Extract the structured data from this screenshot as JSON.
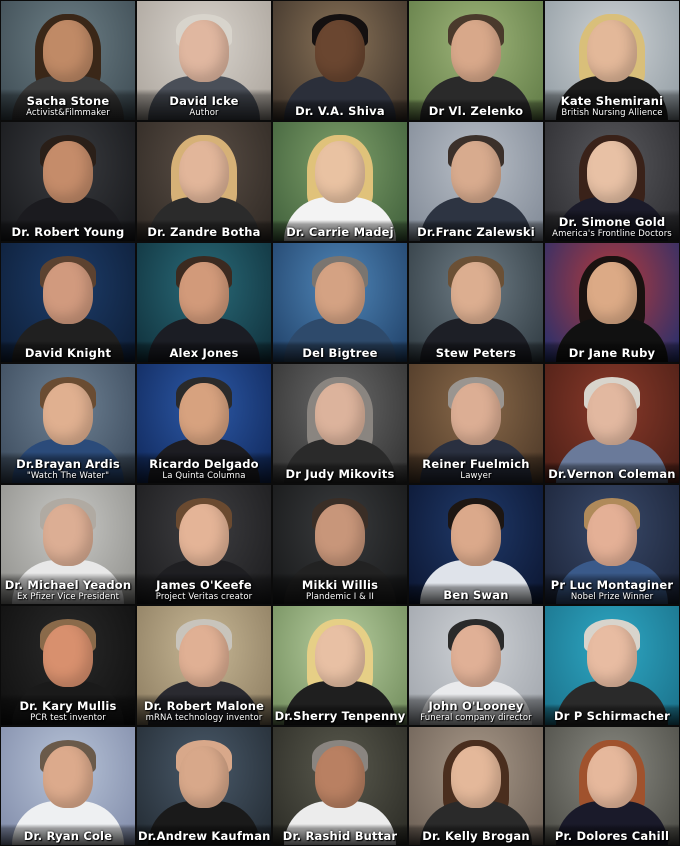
{
  "people": [
    {
      "name": "Sacha Stone",
      "title": "Activist&Filmmaker",
      "bg": "#6d7f86",
      "bg2": "#3c4a52",
      "skin": "#c08a66",
      "hair": "#3a2718",
      "long_hair": true,
      "shirt": "#3b3b3b"
    },
    {
      "name": "David Icke",
      "title": "Author",
      "bg": "#d9d4cd",
      "bg2": "#a9a29a",
      "skin": "#e0b7a0",
      "hair": "#d8d4cc",
      "long_hair": false,
      "shirt": "#4a4f58"
    },
    {
      "name": "Dr. V.A. Shiva",
      "title": "",
      "bg": "#8a7358",
      "bg2": "#3a3028",
      "skin": "#6a4630",
      "hair": "#141010",
      "long_hair": false,
      "shirt": "#2b2f3a"
    },
    {
      "name": "Dr Vl. Zelenko",
      "title": "",
      "bg": "#9fb57a",
      "bg2": "#5f7a45",
      "skin": "#d8a88a",
      "hair": "#4a3a2c",
      "long_hair": false,
      "shirt": "#2a2a2a"
    },
    {
      "name": "Kate Shemirani",
      "title": "British Nursing Allience",
      "bg": "#cfd3d6",
      "bg2": "#8f9aa1",
      "skin": "#e3b899",
      "hair": "#d9bf7a",
      "long_hair": true,
      "shirt": "#1d1d1d"
    },
    {
      "name": "Dr. Robert Young",
      "title": "",
      "bg": "#3a3c40",
      "bg2": "#16171a",
      "skin": "#c58c6a",
      "hair": "#2a1f18",
      "long_hair": false,
      "shirt": "#1b1b1f"
    },
    {
      "name": "Dr. Zandre Botha",
      "title": "",
      "bg": "#5b4f46",
      "bg2": "#2e2823",
      "skin": "#e2b69a",
      "hair": "#d6b177",
      "long_hair": true,
      "shirt": "#2b2b2b"
    },
    {
      "name": "Dr. Carrie Madej",
      "title": "",
      "bg": "#7fa06a",
      "bg2": "#3e5e3a",
      "skin": "#e9c2a2",
      "hair": "#e0c27a",
      "long_hair": true,
      "shirt": "#f3f3f3"
    },
    {
      "name": "Dr.Franc Zalewski",
      "title": "",
      "bg": "#b9bfc7",
      "bg2": "#7f8895",
      "skin": "#d8ab8e",
      "hair": "#3b302a",
      "long_hair": false,
      "shirt": "#2d3442"
    },
    {
      "name": "Dr. Simone Gold",
      "title": "America's Frontline Doctors",
      "bg": "#5a5a5e",
      "bg2": "#2a2a2e",
      "skin": "#e8c1a5",
      "hair": "#3a2219",
      "long_hair": true,
      "shirt": "#1b1b2a"
    },
    {
      "name": "David Knight",
      "title": "",
      "bg": "#1d3d6a",
      "bg2": "#0d1d36",
      "skin": "#d19a7e",
      "hair": "#5c4230",
      "long_hair": false,
      "shirt": "#202020"
    },
    {
      "name": "Alex Jones",
      "title": "",
      "bg": "#2a6b79",
      "bg2": "#0f2f3a",
      "skin": "#d29a7a",
      "hair": "#3b2a20",
      "long_hair": false,
      "shirt": "#1b1d24"
    },
    {
      "name": "Del Bigtree",
      "title": "",
      "bg": "#4f86b8",
      "bg2": "#1f3f66",
      "skin": "#d4a283",
      "hair": "#7a7570",
      "long_hair": false,
      "shirt": "#2e4a6b"
    },
    {
      "name": "Stew Peters",
      "title": "",
      "bg": "#6f7d86",
      "bg2": "#2e3940",
      "skin": "#dcae90",
      "hair": "#6b5035",
      "long_hair": false,
      "shirt": "#1d1f26"
    },
    {
      "name": "Dr Jane Ruby",
      "title": "",
      "bg": "#b73a3a",
      "bg2": "#1f2f6f",
      "skin": "#dcaa86",
      "hair": "#1a1210",
      "long_hair": true,
      "shirt": "#111111"
    },
    {
      "name": "Dr.Brayan Ardis",
      "title": "\"Watch The Water\"",
      "bg": "#6f8294",
      "bg2": "#39485a",
      "skin": "#e0b090",
      "hair": "#6a4c32",
      "long_hair": false,
      "shirt": "#2b4b7a"
    },
    {
      "name": "Ricardo Delgado",
      "title": "La Quinta Columna",
      "bg": "#2d5aa8",
      "bg2": "#0f2658",
      "skin": "#d7a27f",
      "hair": "#2a2a2a",
      "long_hair": false,
      "shirt": "#1d1d22"
    },
    {
      "name": "Dr Judy Mikovits",
      "title": "",
      "bg": "#6a6a6a",
      "bg2": "#2f2f2f",
      "skin": "#dcb39c",
      "hair": "#8a8580",
      "long_hair": true,
      "shirt": "#2a2a2a"
    },
    {
      "name": "Reiner Fuelmich",
      "title": "Lawyer",
      "bg": "#8a6a4a",
      "bg2": "#4a3626",
      "skin": "#dcae94",
      "hair": "#9a9590",
      "long_hair": false,
      "shirt": "#2a3040"
    },
    {
      "name": "Dr.Vernon Coleman",
      "title": "",
      "bg": "#8a3a2a",
      "bg2": "#4a1e16",
      "skin": "#e2b8a0",
      "hair": "#d8d4cc",
      "long_hair": false,
      "shirt": "#6a7a9a"
    },
    {
      "name": "Dr. Michael Yeadon",
      "title": "Ex Pfizer Vice President",
      "bg": "#c9c9c6",
      "bg2": "#8e8e8a",
      "skin": "#dcae94",
      "hair": "#b0aaa2",
      "long_hair": false,
      "shirt": "#e8e8e8"
    },
    {
      "name": "James O'Keefe",
      "title": "Project Veritas creator",
      "bg": "#3f3f42",
      "bg2": "#1a1a1c",
      "skin": "#e4b497",
      "hair": "#6a4a30",
      "long_hair": false,
      "shirt": "#1f1f22"
    },
    {
      "name": "Mikki Willis",
      "title": "Plandemic I & II",
      "bg": "#3a3c3e",
      "bg2": "#151617",
      "skin": "#c8967a",
      "hair": "#3a2e26",
      "long_hair": false,
      "shirt": "#222222"
    },
    {
      "name": "Ben Swan",
      "title": "",
      "bg": "#203a6a",
      "bg2": "#0b1530",
      "skin": "#dba98b",
      "hair": "#1d1612",
      "long_hair": false,
      "shirt": "#dfe3ea"
    },
    {
      "name": "Pr Luc Montaginer",
      "title": "Nobel Prize Winner",
      "bg": "#3a4a6a",
      "bg2": "#1a2236",
      "skin": "#e4b096",
      "hair": "#b08a5a",
      "long_hair": false,
      "shirt": "#3a5a8a"
    },
    {
      "name": "Dr. Kary Mullis",
      "title": "PCR test inventor",
      "bg": "#2a2a2a",
      "bg2": "#0e0e0e",
      "skin": "#d8906e",
      "hair": "#8a6a4a",
      "long_hair": false,
      "shirt": "#1a1a1a"
    },
    {
      "name": "Dr. Robert Malone",
      "title": "mRNA technology inventor",
      "bg": "#c8b896",
      "bg2": "#8a7a5e",
      "skin": "#e0b094",
      "hair": "#c8c4bc",
      "long_hair": false,
      "shirt": "#2a2a30"
    },
    {
      "name": "Dr.Sherry Tenpenny",
      "title": "",
      "bg": "#b8cfa0",
      "bg2": "#6f8a5a",
      "skin": "#e8c0a4",
      "hair": "#e6cf86",
      "long_hair": true,
      "shirt": "#1f1f1f"
    },
    {
      "name": "John O'Looney",
      "title": "Funeral company director",
      "bg": "#cfd2d6",
      "bg2": "#9ea3aa",
      "skin": "#e0b096",
      "hair": "#2a2a2a",
      "long_hair": false,
      "shirt": "#e9eaec"
    },
    {
      "name": "Dr P Schirmacher",
      "title": "",
      "bg": "#2ea8c4",
      "bg2": "#1a6f88",
      "skin": "#e8bca2",
      "hair": "#d8d4cc",
      "long_hair": false,
      "shirt": "#2a2a2a"
    },
    {
      "name": "Dr. Ryan Cole",
      "title": "",
      "bg": "#b8c4d8",
      "bg2": "#7f8aa8",
      "skin": "#dcaa8c",
      "hair": "#6a5a4a",
      "long_hair": false,
      "shirt": "#eef0f2"
    },
    {
      "name": "Dr.Andrew Kaufman",
      "title": "",
      "bg": "#4a5a6a",
      "bg2": "#222a32",
      "skin": "#d8a88a",
      "hair": "#d8a88a",
      "long_hair": false,
      "shirt": "#1a1a1a"
    },
    {
      "name": "Dr. Rashid Buttar",
      "title": "",
      "bg": "#5a5a4e",
      "bg2": "#2a2a24",
      "skin": "#b98062",
      "hair": "#8a8580",
      "long_hair": false,
      "shirt": "#ececec"
    },
    {
      "name": "Dr. Kelly Brogan",
      "title": "",
      "bg": "#a89888",
      "bg2": "#6a5e54",
      "skin": "#e4b89a",
      "hair": "#4a2e1e",
      "long_hair": true,
      "shirt": "#2a2a2a"
    },
    {
      "name": "Pr. Dolores Cahill",
      "title": "",
      "bg": "#8a8a82",
      "bg2": "#4a4a44",
      "skin": "#e6b89c",
      "hair": "#a0522d",
      "long_hair": true,
      "shirt": "#1a1a2a"
    }
  ]
}
